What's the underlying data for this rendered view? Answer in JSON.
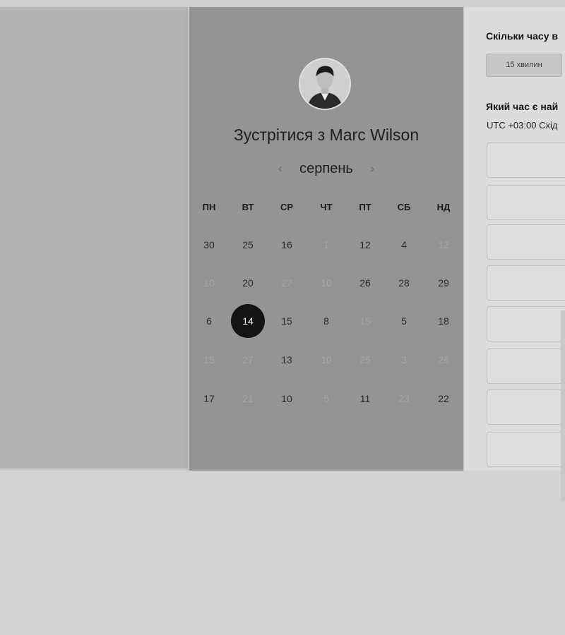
{
  "host": {
    "meet_title": "Зустрітися з Marc Wilson"
  },
  "calendar": {
    "month": "серпень",
    "prev_symbol": "‹",
    "next_symbol": "›",
    "weekdays": [
      "ПН",
      "ВТ",
      "СР",
      "ЧТ",
      "ПТ",
      "СБ",
      "НД"
    ],
    "weeks": [
      [
        {
          "label": "30",
          "state": "active"
        },
        {
          "label": "25",
          "state": "active"
        },
        {
          "label": "16",
          "state": "active"
        },
        {
          "label": "1",
          "state": "muted"
        },
        {
          "label": "12",
          "state": "active"
        },
        {
          "label": "4",
          "state": "active"
        },
        {
          "label": "12",
          "state": "muted"
        }
      ],
      [
        {
          "label": "10",
          "state": "muted"
        },
        {
          "label": "20",
          "state": "active"
        },
        {
          "label": "27",
          "state": "muted"
        },
        {
          "label": "10",
          "state": "muted"
        },
        {
          "label": "26",
          "state": "active"
        },
        {
          "label": "28",
          "state": "active"
        },
        {
          "label": "29",
          "state": "active"
        }
      ],
      [
        {
          "label": "6",
          "state": "active"
        },
        {
          "label": "14",
          "state": "selected"
        },
        {
          "label": "15",
          "state": "active"
        },
        {
          "label": "8",
          "state": "active"
        },
        {
          "label": "15",
          "state": "muted"
        },
        {
          "label": "5",
          "state": "active"
        },
        {
          "label": "18",
          "state": "active"
        }
      ],
      [
        {
          "label": "15",
          "state": "muted"
        },
        {
          "label": "27",
          "state": "muted"
        },
        {
          "label": "13",
          "state": "active"
        },
        {
          "label": "10",
          "state": "muted"
        },
        {
          "label": "25",
          "state": "muted"
        },
        {
          "label": "3",
          "state": "muted"
        },
        {
          "label": "26",
          "state": "muted"
        }
      ],
      [
        {
          "label": "17",
          "state": "active"
        },
        {
          "label": "21",
          "state": "muted"
        },
        {
          "label": "10",
          "state": "active"
        },
        {
          "label": "5",
          "state": "muted"
        },
        {
          "label": "11",
          "state": "active"
        },
        {
          "label": "23",
          "state": "muted"
        },
        {
          "label": "22",
          "state": "active"
        }
      ]
    ]
  },
  "booking": {
    "duration_question": "Скільки часу в",
    "duration_option": "15 хвилин",
    "time_question": "Який час є най",
    "timezone": "UTC +03:00 Схід",
    "slot_count": 8
  },
  "colors": {
    "selected_day_bg": "#141414",
    "calendar_panel_bg": "#949494",
    "muted_day": "#a6a6a6"
  }
}
